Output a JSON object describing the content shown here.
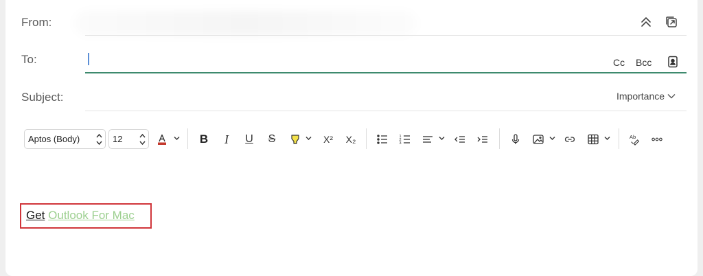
{
  "header": {
    "from_label": "From:",
    "to_label": "To:",
    "subject_label": "Subject:",
    "cc_label": "Cc",
    "bcc_label": "Bcc",
    "importance_label": "Importance"
  },
  "format_toolbar": {
    "font_family": "Aptos (Body)",
    "font_size": "12",
    "font_color": "#c43a2e",
    "highlight_color": "#f4e24a",
    "bold": "B",
    "italic": "I",
    "underline": "U",
    "strike": "S",
    "superscript": "X²",
    "subscript": "X₂"
  },
  "body": {
    "signature_prefix": "Get",
    "signature_link": "Outlook For Mac"
  },
  "colors": {
    "accent_underline": "#3e8a6e",
    "cursor": "#5c8fd6",
    "highlight_box": "#d0353a",
    "link": "#9ccf8f"
  }
}
